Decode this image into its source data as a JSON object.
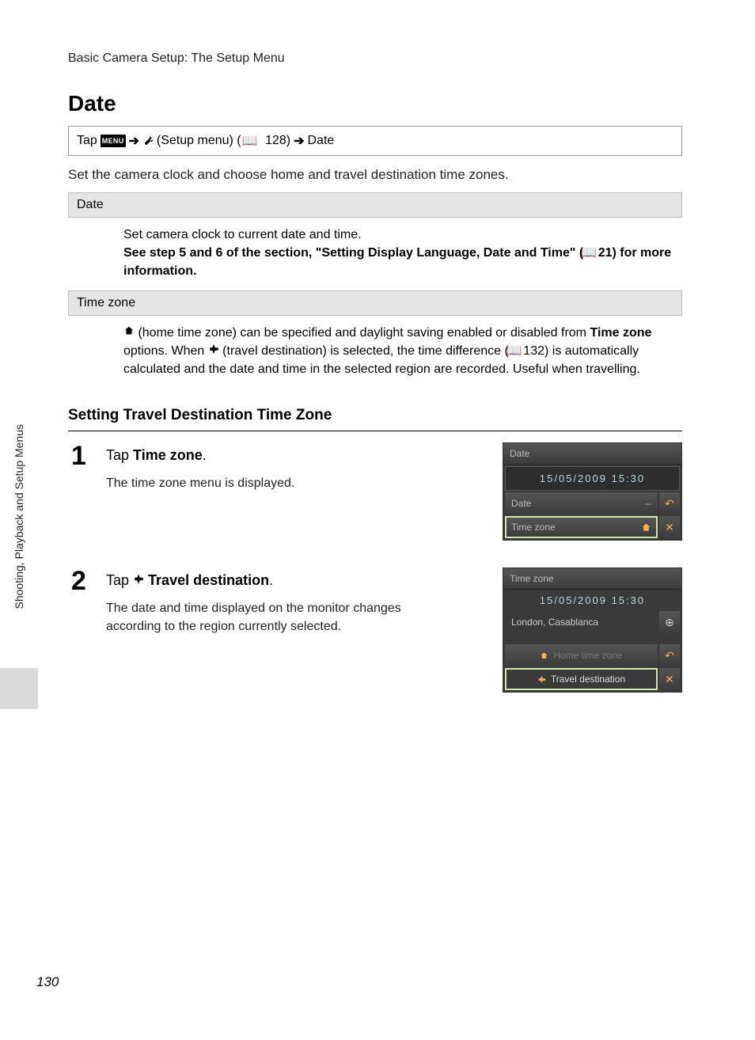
{
  "header": "Basic Camera Setup: The Setup Menu",
  "title": "Date",
  "nav": {
    "tap": "Tap",
    "menu_chip": "MENU",
    "setup_menu": "(Setup menu) (",
    "page_ref": "128)",
    "date": "Date"
  },
  "intro": "Set the camera clock and choose home and travel destination time zones.",
  "table": {
    "row1": {
      "head": "Date",
      "line1": "Set camera clock to current date and time.",
      "line2a": "See step 5 and 6 of the section, \"Setting Display Language, Date and Time\" (",
      "line2b": "21) for more information."
    },
    "row2": {
      "head": "Time zone",
      "text1": " (home time zone) can be specified and daylight saving enabled or disabled from ",
      "text2": "Time zone",
      "text3": " options. When ",
      "text4": " (travel destination) is selected, the time difference (",
      "text5": "132) is automatically calculated and the date and time in the selected region are recorded. Useful when travelling."
    }
  },
  "section_heading": "Setting Travel Destination Time Zone",
  "steps": {
    "s1": {
      "num": "1",
      "title_pre": "Tap ",
      "title_bold": "Time zone",
      "title_post": ".",
      "desc": "The time zone menu is displayed."
    },
    "s2": {
      "num": "2",
      "title_pre": "Tap ",
      "title_bold": "Travel destination",
      "title_post": ".",
      "desc": "The date and time displayed on the monitor changes according to the region currently selected."
    }
  },
  "screen1": {
    "title": "Date",
    "datetime": "15/05/2009 15:30",
    "date_label": "Date",
    "date_val": "--",
    "tz_label": "Time zone"
  },
  "screen2": {
    "title": "Time zone",
    "datetime": "15/05/2009 15:30",
    "location": "London, Casablanca",
    "home": "Home time zone",
    "travel": "Travel destination"
  },
  "side_label": "Shooting, Playback and Setup Menus",
  "page_number": "130"
}
